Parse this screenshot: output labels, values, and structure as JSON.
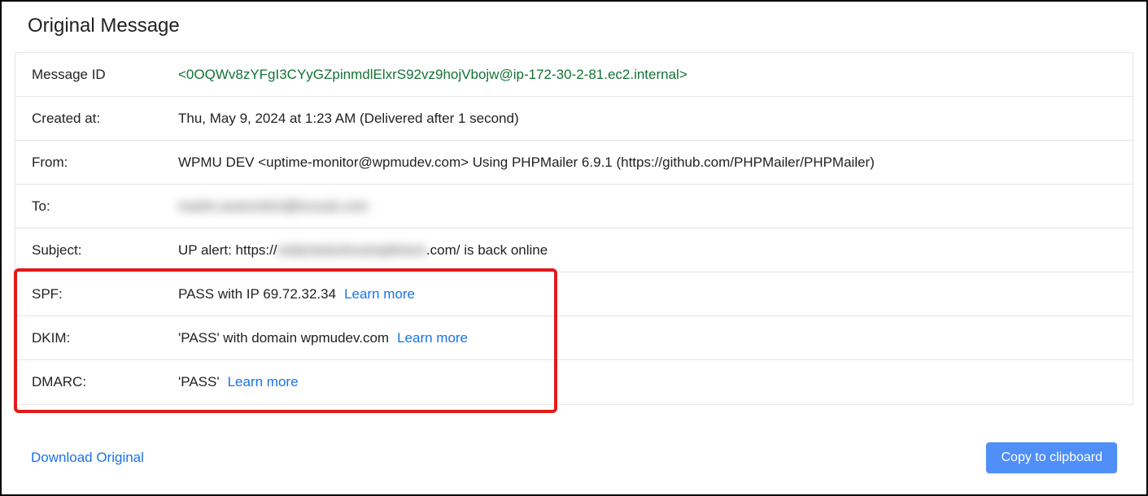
{
  "title": "Original Message",
  "rows": {
    "messageId": {
      "label": "Message ID",
      "value": "<0OQWv8zYFgI3CYyGZpinmdlElxrS92vz9hojVbojw@ip-172-30-2-81.ec2.internal>"
    },
    "createdAt": {
      "label": "Created at:",
      "value": "Thu, May 9, 2024 at 1:23 AM (Delivered after 1 second)"
    },
    "from": {
      "label": "From:",
      "value": "WPMU DEV <uptime-monitor@wpmudev.com> Using PHPMailer 6.9.1 (https://github.com/PHPMailer/PHPMailer)"
    },
    "to": {
      "label": "To:",
      "redacted": "martin.aranovitch@incsub.com"
    },
    "subject": {
      "label": "Subject:",
      "prefix": "UP alert: https://",
      "redacted": "redactedurlexamplehere",
      "suffix": ".com/ is back online"
    },
    "spf": {
      "label": "SPF:",
      "value": "PASS with IP 69.72.32.34",
      "learnMore": "Learn more"
    },
    "dkim": {
      "label": "DKIM:",
      "value": "'PASS' with domain wpmudev.com",
      "learnMore": "Learn more"
    },
    "dmarc": {
      "label": "DMARC:",
      "value": "'PASS'",
      "learnMore": "Learn more"
    }
  },
  "actions": {
    "download": "Download Original",
    "copy": "Copy to clipboard"
  }
}
